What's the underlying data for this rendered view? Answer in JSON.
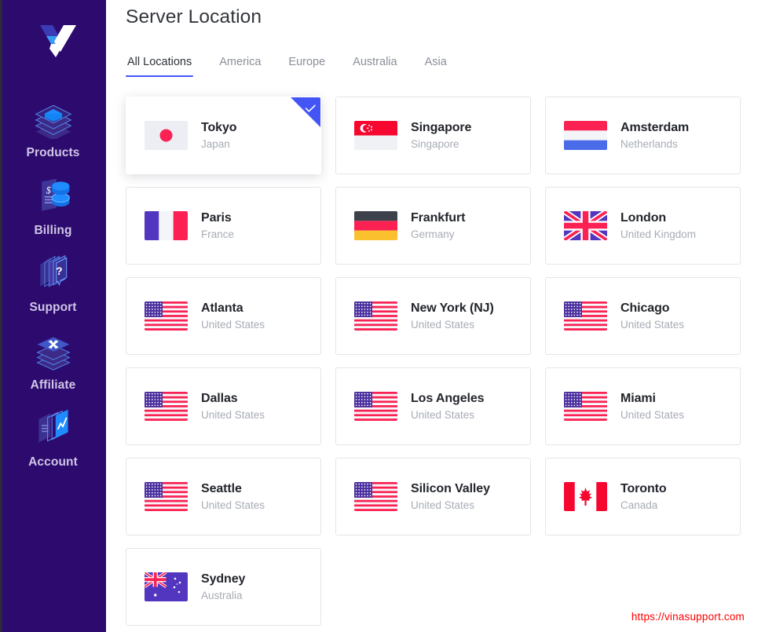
{
  "sidebar": {
    "logo_name": "vultr-logo",
    "items": [
      {
        "label": "Products",
        "icon": "layers-cube-icon",
        "key": "products"
      },
      {
        "label": "Billing",
        "icon": "invoice-coins-icon",
        "key": "billing"
      },
      {
        "label": "Support",
        "icon": "chat-question-icon",
        "key": "support"
      },
      {
        "label": "Affiliate",
        "icon": "layers-x-icon",
        "key": "affiliate"
      },
      {
        "label": "Account",
        "icon": "windows-chart-icon",
        "key": "account"
      }
    ]
  },
  "header": {
    "title": "Server Location"
  },
  "tabs": {
    "active": "All Locations",
    "items": [
      {
        "label": "All Locations",
        "active": true
      },
      {
        "label": "America",
        "active": false
      },
      {
        "label": "Europe",
        "active": false
      },
      {
        "label": "Australia",
        "active": false
      },
      {
        "label": "Asia",
        "active": false
      }
    ]
  },
  "colors": {
    "sidebar_bg": "#2d0a6e",
    "accent_blue": "#4355f5",
    "card_border": "#e3e5e9",
    "city_text": "#22252b",
    "country_text": "#a7acb5",
    "watermark_red": "#ff0000"
  },
  "locations": [
    {
      "city": "Tokyo",
      "country": "Japan",
      "flag": "jp",
      "selected": true
    },
    {
      "city": "Singapore",
      "country": "Singapore",
      "flag": "sg",
      "selected": false
    },
    {
      "city": "Amsterdam",
      "country": "Netherlands",
      "flag": "nl",
      "selected": false
    },
    {
      "city": "Paris",
      "country": "France",
      "flag": "fr",
      "selected": false
    },
    {
      "city": "Frankfurt",
      "country": "Germany",
      "flag": "de",
      "selected": false
    },
    {
      "city": "London",
      "country": "United Kingdom",
      "flag": "gb",
      "selected": false
    },
    {
      "city": "Atlanta",
      "country": "United States",
      "flag": "us",
      "selected": false
    },
    {
      "city": "New York (NJ)",
      "country": "United States",
      "flag": "us",
      "selected": false
    },
    {
      "city": "Chicago",
      "country": "United States",
      "flag": "us",
      "selected": false
    },
    {
      "city": "Dallas",
      "country": "United States",
      "flag": "us",
      "selected": false
    },
    {
      "city": "Los Angeles",
      "country": "United States",
      "flag": "us",
      "selected": false
    },
    {
      "city": "Miami",
      "country": "United States",
      "flag": "us",
      "selected": false
    },
    {
      "city": "Seattle",
      "country": "United States",
      "flag": "us",
      "selected": false
    },
    {
      "city": "Silicon Valley",
      "country": "United States",
      "flag": "us",
      "selected": false
    },
    {
      "city": "Toronto",
      "country": "Canada",
      "flag": "ca",
      "selected": false
    },
    {
      "city": "Sydney",
      "country": "Australia",
      "flag": "au",
      "selected": false
    }
  ],
  "footer": {
    "watermark": "https://vinasupport.com"
  }
}
